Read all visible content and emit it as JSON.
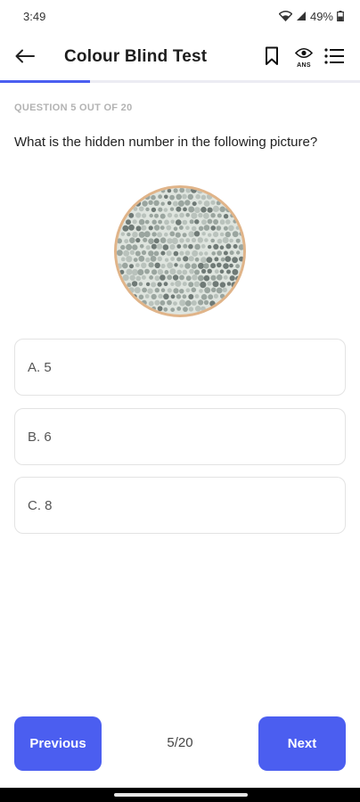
{
  "status": {
    "time": "3:49",
    "battery": "49%"
  },
  "header": {
    "title": "Colour Blind Test",
    "answer_label": "ANS"
  },
  "progress": {
    "fraction": 0.25
  },
  "question": {
    "counter": "QUESTION 5 OUT OF 20",
    "text": "What is the hidden number in the following picture?"
  },
  "options": [
    {
      "label": "A. 5"
    },
    {
      "label": "B. 6"
    },
    {
      "label": "C. 8"
    }
  ],
  "footer": {
    "previous_label": "Previous",
    "next_label": "Next",
    "page": "5/20"
  },
  "colors": {
    "accent": "#4b5ef0",
    "plate_border": "#e0b489",
    "dot_light": "#b9c2bc",
    "dot_mid": "#9aa59f",
    "dot_dark": "#6f7a76"
  },
  "icons": [
    "back-arrow-icon",
    "bookmark-icon",
    "eye-icon",
    "list-icon",
    "wifi-icon",
    "signal-icon",
    "battery-icon"
  ]
}
